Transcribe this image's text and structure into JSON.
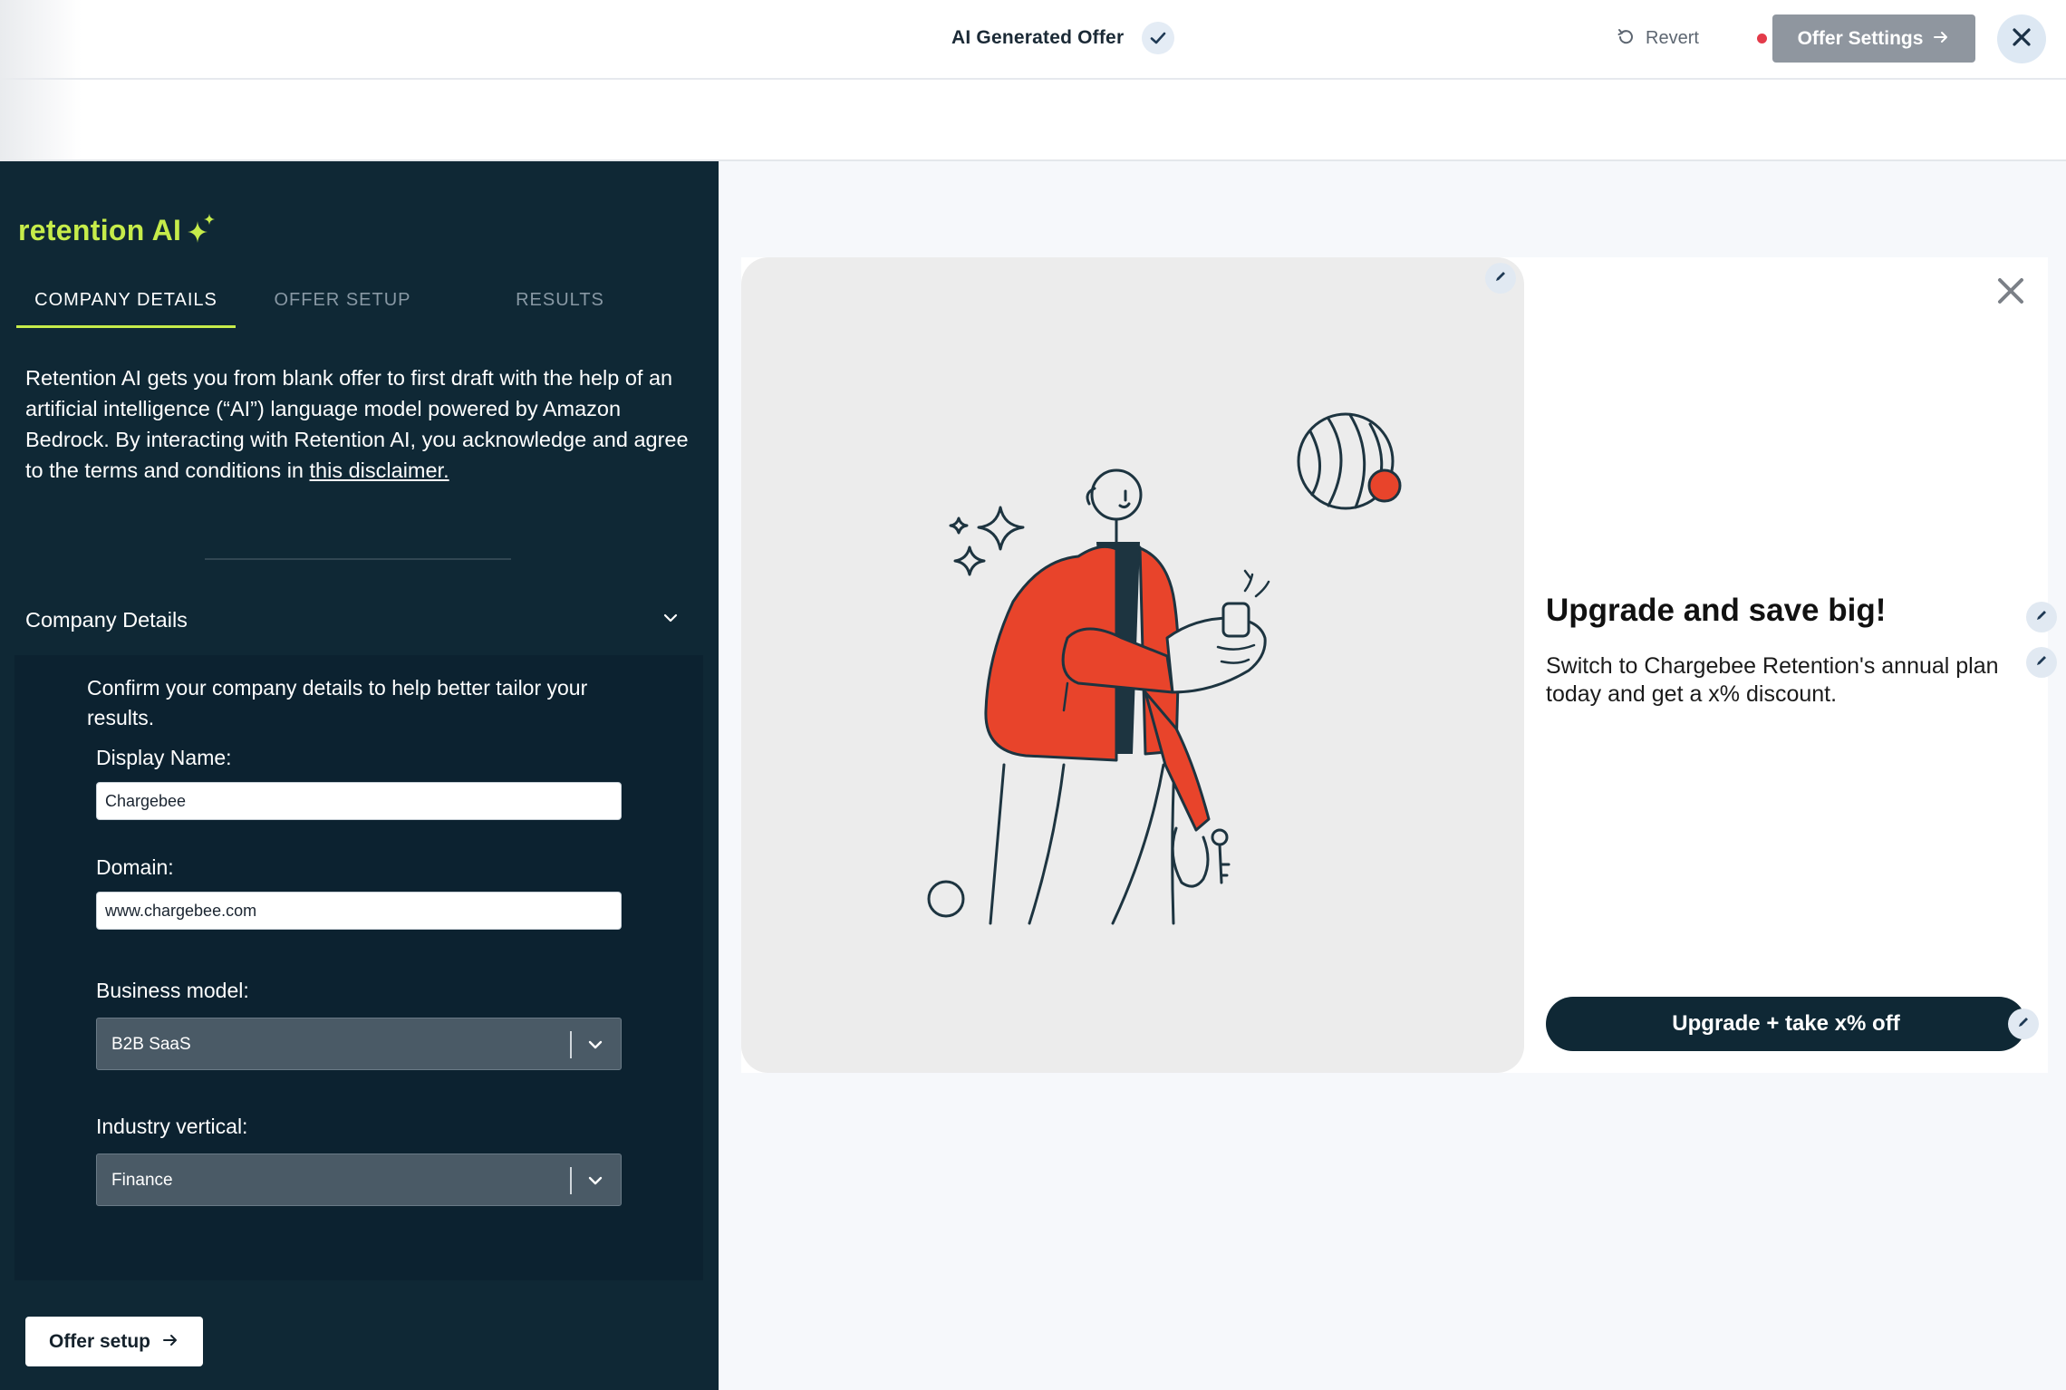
{
  "topbar": {
    "title": "AI Generated Offer",
    "revert_label": "Revert",
    "offer_settings_label": "Offer Settings"
  },
  "sidebar": {
    "brand": "retention AI",
    "tabs": [
      {
        "label": "COMPANY DETAILS",
        "active": true
      },
      {
        "label": "OFFER SETUP",
        "active": false
      },
      {
        "label": "RESULTS",
        "active": false
      }
    ],
    "intro_text": "Retention AI gets you from blank offer to first draft with the help of an artificial intelligence (“AI”) language model powered by Amazon Bedrock. By interacting with Retention AI, you acknowledge and agree to the terms and conditions in",
    "intro_link": "this disclaimer.",
    "accordion": {
      "title": "Company Details",
      "description": "Confirm your company details to help better tailor your results.",
      "display_name": {
        "label": "Display Name:",
        "value": "Chargebee"
      },
      "domain": {
        "label": "Domain:",
        "value": "www.chargebee.com"
      },
      "business_model": {
        "label": "Business model:",
        "value": "B2B SaaS"
      },
      "industry_vertical": {
        "label": "Industry vertical:",
        "value": "Finance"
      }
    },
    "next_button": "Offer setup"
  },
  "offer": {
    "headline": "Upgrade and save big!",
    "body": "Switch to Chargebee Retention's annual plan today and get a x% discount.",
    "cta_label": "Upgrade + take x% off"
  },
  "colors": {
    "sidebar_bg": "#0f2835",
    "brand_accent": "#c6ec4a",
    "illustration_orange": "#e8442b",
    "cta_bg": "#0f2835"
  },
  "icons": [
    "check-icon",
    "revert-icon",
    "arrow-right-icon",
    "close-icon",
    "sparkle-icon",
    "chevron-down-icon",
    "pencil-icon"
  ]
}
